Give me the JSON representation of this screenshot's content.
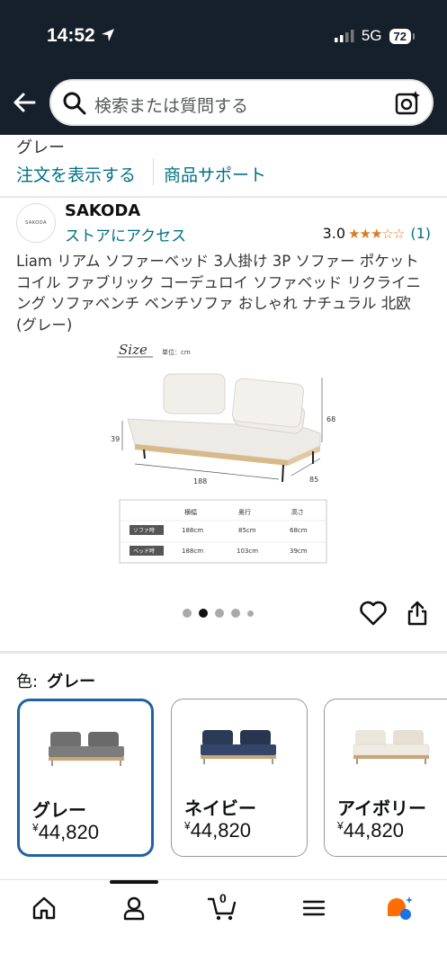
{
  "status": {
    "time": "14:52",
    "network": "5G",
    "battery": "72"
  },
  "search": {
    "placeholder": "検索または質問する"
  },
  "variant_text_top": "グレー",
  "links": {
    "orders": "注文を表示する",
    "support": "商品サポート"
  },
  "brand": {
    "name": "SAKODA",
    "logo_text": "SAKODA",
    "store_link": "ストアにアクセス"
  },
  "rating": {
    "value": "3.0",
    "stars": 3,
    "count": "(1)"
  },
  "product_title": "Liam リアム ソファーベッド 3人掛け 3P ソファー ポケットコイル ファブリック コーデュロイ ソファベッド リクライニング ソファベンチ ベンチソファ おしゃれ ナチュラル 北欧 (グレー)",
  "image": {
    "size_label": "Size",
    "unit_label": "単位：cm",
    "dims": {
      "height": "68",
      "seat": "39",
      "width": "188",
      "depth": "85"
    },
    "table": {
      "headers": [
        "横幅",
        "奥行",
        "高さ"
      ],
      "rows": [
        {
          "label": "ソファ時",
          "cells": [
            "188cm",
            "85cm",
            "68cm"
          ]
        },
        {
          "label": "ベッド時",
          "cells": [
            "188cm",
            "103cm",
            "39cm"
          ]
        }
      ]
    }
  },
  "carousel": {
    "count": 5,
    "active_index": 1
  },
  "color": {
    "label": "色:",
    "selected": "グレー"
  },
  "variants": [
    {
      "name": "グレー",
      "currency": "¥",
      "price": "44,820",
      "color": "#6f6f6f",
      "selected": true
    },
    {
      "name": "ネイビー",
      "currency": "¥",
      "price": "44,820",
      "color": "#2b3a55",
      "selected": false
    },
    {
      "name": "アイボリー",
      "currency": "¥",
      "price": "44,820",
      "color": "#e8e2d6",
      "selected": false
    }
  ],
  "nav": {
    "cart_count": "0"
  },
  "colors": {
    "dark_header": "#16202b",
    "link": "#007185",
    "selected_border": "#2162a1",
    "star": "#de7921"
  }
}
